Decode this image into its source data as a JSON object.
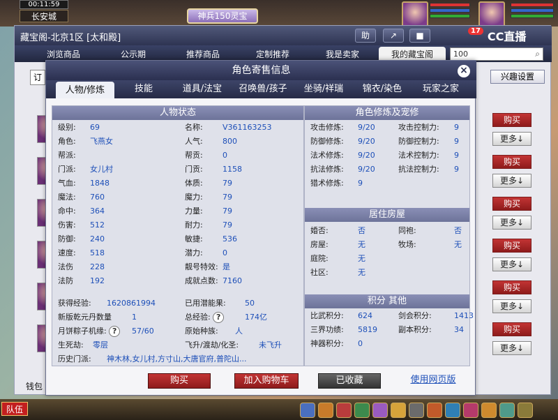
{
  "hud": {
    "clock": "00:11:59",
    "city": "长安城",
    "event": "神兵150灵宝",
    "team": "队伍"
  },
  "window": {
    "title": "藏宝阁-北京1区 [太和殿]",
    "btn_help": "助",
    "mail_count": "17",
    "brand": "CC直播",
    "nav": [
      "浏览商品",
      "公示期",
      "推荐商品",
      "定制推荐",
      "我是卖家",
      "我的藏宝阁"
    ],
    "search_value": "100",
    "interest": "兴趣设置",
    "buy": "购买",
    "more": "更多↓",
    "wallet": "钱包",
    "ding": "订"
  },
  "modal": {
    "title": "角色寄售信息",
    "tabs": [
      "人物/修炼",
      "技能",
      "道具/法宝",
      "召唤兽/孩子",
      "坐骑/祥瑞",
      "锦衣/染色",
      "玩家之家"
    ],
    "status_head": "人物状态",
    "left_col": [
      [
        "级别:",
        "69"
      ],
      [
        "角色:",
        "飞燕女"
      ],
      [
        "帮派:",
        ""
      ],
      [
        "门派:",
        "女儿村"
      ],
      [
        "气血:",
        "1848"
      ],
      [
        "魔法:",
        "760"
      ],
      [
        "命中:",
        "364"
      ],
      [
        "伤害:",
        "512"
      ],
      [
        "防御:",
        "240"
      ],
      [
        "速度:",
        "518"
      ],
      [
        "法伤",
        "228"
      ],
      [
        "法防",
        "192"
      ]
    ],
    "right_col": [
      [
        "名称:",
        "V361163253"
      ],
      [
        "人气:",
        "800"
      ],
      [
        "帮贡:",
        "0"
      ],
      [
        "门贡:",
        "1158"
      ],
      [
        "体质:",
        "79"
      ],
      [
        "魔力:",
        "79"
      ],
      [
        "力量:",
        "79"
      ],
      [
        "耐力:",
        "79"
      ],
      [
        "敏捷:",
        "536"
      ],
      [
        "潜力:",
        "0"
      ],
      [
        "靓号特效:",
        "是"
      ],
      [
        "成就点数:",
        "7160"
      ]
    ],
    "exp_label": "获得经验:",
    "exp_value": "1620861994",
    "used_pot_label": "已用潜能果:",
    "used_pot_value": "50",
    "qkd_label": "新版乾元丹数量",
    "qkd_value": "1",
    "total_exp_label": "总经验:",
    "total_exp_value": "174亿",
    "zongzi_label": "月饼粽子机缘:",
    "zongzi_value": "57/60",
    "race_label": "原始种族:",
    "race_value": "人",
    "birth_label": "生死劫:",
    "birth_value": "零层",
    "fly_label": "飞升/渡劫/化圣:",
    "fly_value": "未飞升",
    "history_label": "历史门派:",
    "history_value": "神木林,女儿村,方寸山,大唐官府,普陀山...",
    "cult_head": "角色修炼及宠修",
    "cult": [
      [
        "攻击修炼:",
        "9/20",
        "攻击控制力:",
        "9"
      ],
      [
        "防御修炼:",
        "9/20",
        "防御控制力:",
        "9"
      ],
      [
        "法术修炼:",
        "9/20",
        "法术控制力:",
        "9"
      ],
      [
        "抗法修炼:",
        "9/20",
        "抗法控制力:",
        "9"
      ],
      [
        "猎术修炼:",
        "9",
        "",
        ""
      ]
    ],
    "house_head": "居住房屋",
    "house": [
      [
        "婚否:",
        "否",
        "同袍:",
        "否"
      ],
      [
        "房屋:",
        "无",
        "牧场:",
        "无"
      ],
      [
        "庭院:",
        "无",
        "",
        ""
      ],
      [
        "社区:",
        "无",
        "",
        ""
      ]
    ],
    "score_head": "积分 其他",
    "score": [
      [
        "比武积分:",
        "624",
        "剑会积分:",
        "1413"
      ],
      [
        "三界功绩:",
        "5819",
        "副本积分:",
        "34"
      ],
      [
        "神器积分:",
        "0",
        "",
        ""
      ]
    ],
    "foot": {
      "buy": "购买",
      "cart": "加入购物车",
      "fav": "已收藏",
      "web": "使用网页版"
    },
    "help_q": "?"
  }
}
